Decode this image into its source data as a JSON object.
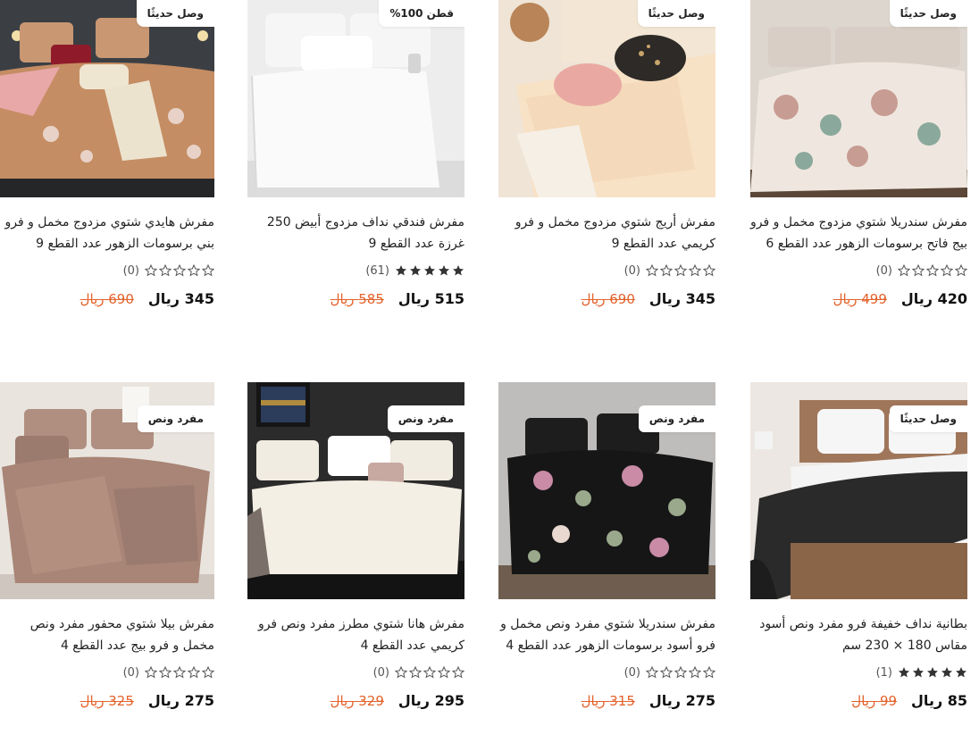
{
  "products": [
    {
      "badge": "وصل حديثًا",
      "title": "مفرش سندريلا شتوي مزدوج مخمل و فرو بيج فاتح برسومات الزهور عدد القطع 6",
      "rating": 0,
      "reviews": "(0)",
      "price": "420 ريال",
      "old_price": "499 ريال",
      "palette": [
        "#cfc3b8",
        "#efe7df",
        "#b88f86",
        "#8aa89b"
      ]
    },
    {
      "badge": "وصل حديثًا",
      "title": "مفرش أريج شتوي مزدوج مخمل و فرو كريمي عدد القطع 9",
      "rating": 0,
      "reviews": "(0)",
      "price": "345 ريال",
      "old_price": "690 ريال",
      "palette": [
        "#f1ddc2",
        "#f8e8d4",
        "#e9a9a2",
        "#2d2a27"
      ]
    },
    {
      "badge": "قطن 100%",
      "title": "مفرش فندقي نداف مزدوج أبيض 250 غرزة عدد القطع 9",
      "rating": 5,
      "reviews": "(61)",
      "price": "515 ريال",
      "old_price": "585 ريال",
      "palette": [
        "#e7e7e7",
        "#fafafa",
        "#d5d5d5",
        "#bdbdbd"
      ]
    },
    {
      "badge": "وصل حديثًا",
      "title": "مفرش هايدي شتوي مزدوج مخمل و فرو بني برسومات الزهور عدد القطع 9",
      "rating": 0,
      "reviews": "(0)",
      "price": "345 ريال",
      "old_price": "690 ريال",
      "palette": [
        "#b8845a",
        "#d69d6d",
        "#8f1b2a",
        "#2e3134"
      ]
    },
    {
      "badge": "وصل حديثًا",
      "title": "بطانية نداف خفيفة فرو مفرد ونص أسود مقاس 180 × 230 سم",
      "rating": 5,
      "reviews": "(1)",
      "price": "85 ريال",
      "old_price": "99 ريال",
      "palette": [
        "#ece7e2",
        "#a0765a",
        "#2a2a2a",
        "#f6f6f6"
      ]
    },
    {
      "badge": "مفرد ونص",
      "title": "مفرش سندريلا شتوي مفرد ونص مخمل و فرو أسود برسومات الزهور عدد القطع 4",
      "rating": 0,
      "reviews": "(0)",
      "price": "275 ريال",
      "old_price": "315 ريال",
      "palette": [
        "#bfbdbb",
        "#1a1a1a",
        "#9aa88c",
        "#c98ba6"
      ]
    },
    {
      "badge": "مفرد ونص",
      "title": "مفرش هانا شتوي مطرز مفرد ونص فرو كريمي عدد القطع 4",
      "rating": 0,
      "reviews": "(0)",
      "price": "295 ريال",
      "old_price": "329 ريال",
      "palette": [
        "#2b2b2b",
        "#f1ece1",
        "#7a6f69",
        "#131313"
      ]
    },
    {
      "badge": "مفرد ونص",
      "title": "مفرش بيلا شتوي محفور مفرد ونص مخمل و فرو بيج عدد القطع 4",
      "rating": 0,
      "reviews": "(0)",
      "price": "275 ريال",
      "old_price": "325 ريال",
      "palette": [
        "#e9e4de",
        "#a88576",
        "#c9ab9c",
        "#8e7268"
      ]
    }
  ],
  "colors": {
    "old_price": "#e3632b",
    "star_filled": "#333333",
    "star_empty": "#555555"
  }
}
